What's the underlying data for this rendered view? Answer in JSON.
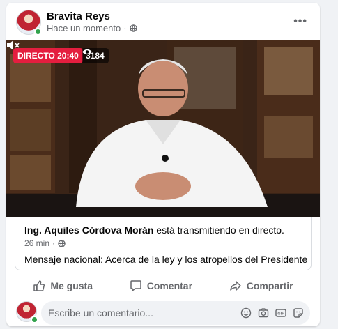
{
  "post": {
    "author": "Bravita Reys",
    "timestamp": "Hace un momento",
    "privacy_icon": "globe-icon",
    "more_icon": "more-options-icon"
  },
  "video": {
    "live_badge": "DIRECTO 20:40",
    "viewer_count": "3184",
    "muted": true
  },
  "shared": {
    "page_name": "Ing. Aquiles Córdova Morán",
    "status_text": " está transmitiendo en directo.",
    "time": "26 min",
    "title": "Mensaje nacional: Acerca de la ley y los atropellos del Presidente"
  },
  "actions": {
    "like": "Me gusta",
    "comment": "Comentar",
    "share": "Compartir"
  },
  "comment": {
    "placeholder": "Escribe un comentario...",
    "icons": [
      "emoji-icon",
      "camera-icon",
      "gif-icon",
      "sticker-icon"
    ]
  },
  "colors": {
    "live": "#e41e3f",
    "online": "#31a24c",
    "secondary_text": "#65676b"
  }
}
